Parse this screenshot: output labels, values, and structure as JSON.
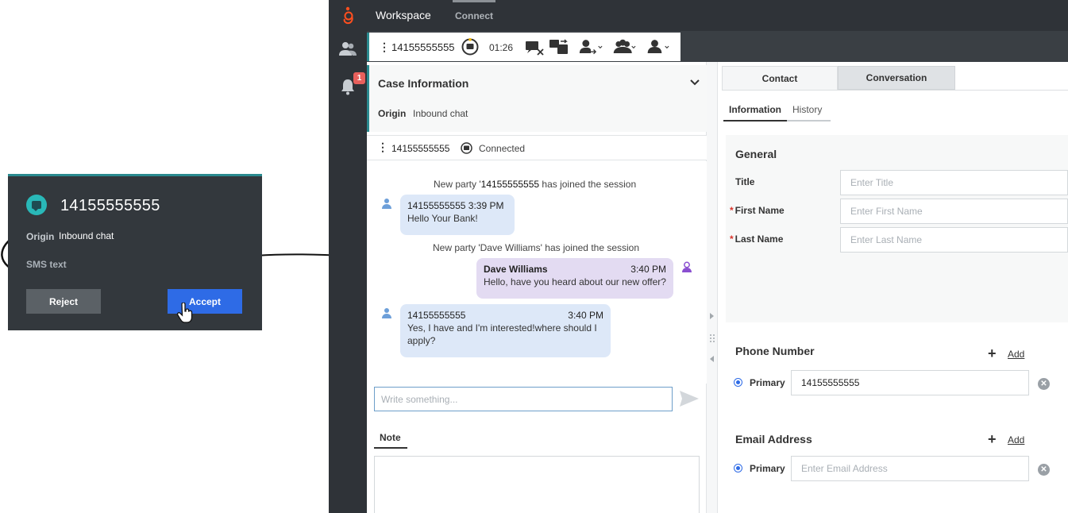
{
  "toast": {
    "phone_number": "14155555555",
    "origin_label": "Origin",
    "origin_value": "Inbound chat",
    "channel": "SMS text",
    "reject_label": "Reject",
    "accept_label": "Accept"
  },
  "app": {
    "title": "Workspace",
    "tab_connect": "Connect",
    "notification_count": "1"
  },
  "toolbar": {
    "phone_number": "14155555555",
    "timer": "01:26"
  },
  "case": {
    "title": "Case Information",
    "origin_label": "Origin",
    "origin_value": "Inbound chat"
  },
  "party": {
    "phone_number": "14155555555",
    "status": "Connected"
  },
  "transcript": {
    "sys_join_1_prefix": "New party '",
    "sys_join_1_number": "14155555555",
    "sys_join_1_suffix": " has joined the session",
    "msg1": {
      "sender": "14155555555",
      "time": "3:39 PM",
      "text": "Hello Your Bank!"
    },
    "sys_join_2": "New party 'Dave Williams' has joined the session",
    "msg2": {
      "sender": "Dave Williams",
      "time": "3:40 PM",
      "text": "Hello, have you heard about our new offer?"
    },
    "msg3": {
      "sender": "14155555555",
      "time": "3:40 PM",
      "text": "Yes, I have and I'm interested!where should I apply?"
    }
  },
  "compose": {
    "placeholder": "Write something...",
    "note_tab": "Note"
  },
  "contact": {
    "tab_contact": "Contact",
    "tab_conversation": "Conversation",
    "subtab_information": "Information",
    "subtab_history": "History",
    "general_title": "General",
    "title_label": "Title",
    "title_placeholder": "Enter Title",
    "first_name_label": "First Name",
    "first_name_placeholder": "Enter First Name",
    "last_name_label": "Last Name",
    "last_name_placeholder": "Enter Last Name",
    "required_marker": "*",
    "phone_section": "Phone Number",
    "add_label": "Add",
    "primary_label": "Primary",
    "phone_value": "14155555555",
    "email_section": "Email Address",
    "email_placeholder": "Enter Email Address",
    "clear_icon_glyph": "✕"
  },
  "colors": {
    "accent_teal": "#2a8a8f",
    "accept_blue": "#2e6be6",
    "dark_chrome": "#2f3338",
    "agent_bubble": "#e3dbf2",
    "customer_bubble": "#dde8f8",
    "genesys_orange": "#ff4f1f"
  }
}
